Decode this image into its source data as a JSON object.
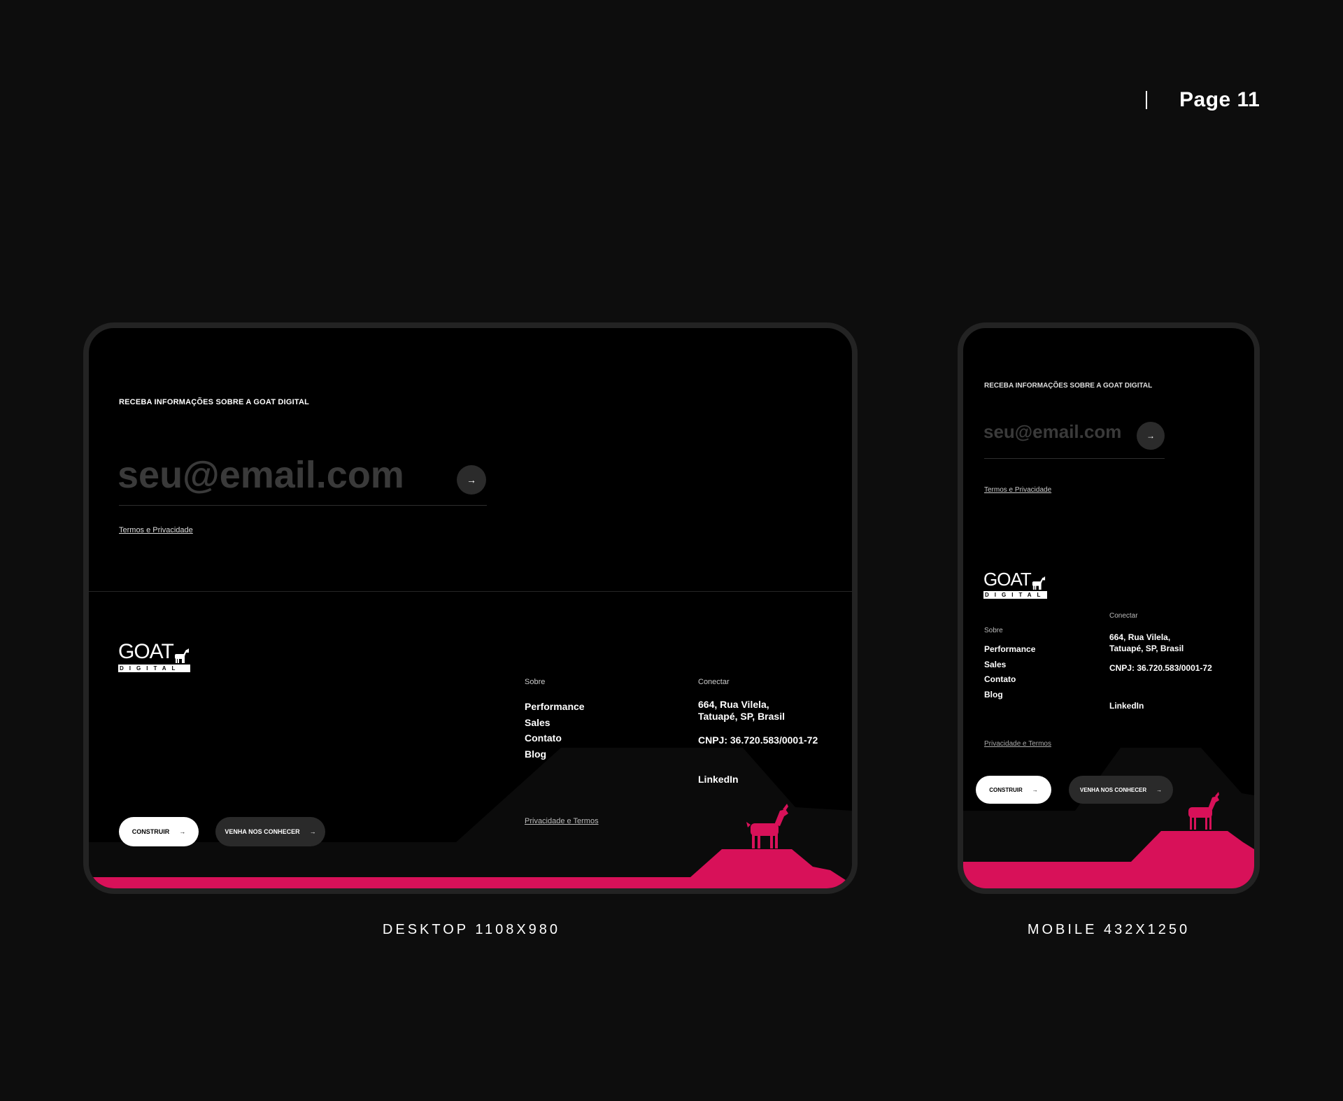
{
  "page_indicator": {
    "label": "Page 11"
  },
  "colors": {
    "accent": "#d81159",
    "background": "#0d0d0d",
    "hill": "#0b0b0b"
  },
  "desktop": {
    "caption": "DESKTOP 1108X980",
    "newsletter_title": "RECEBA INFORMAÇÕES SOBRE A GOAT DIGITAL",
    "email_placeholder": "seu@email.com",
    "submit_icon": "arrow-right-icon",
    "terms_link": "Termos e Privacidade",
    "logo": {
      "main": "GOAT",
      "sub": "DIGITAL"
    },
    "sobre": {
      "title": "Sobre",
      "items": [
        "Performance",
        "Sales",
        "Contato",
        "Blog"
      ]
    },
    "conectar": {
      "title": "Conectar",
      "address_line1": "664, Rua Vilela,",
      "address_line2": "Tatuapé, SP, Brasil",
      "cnpj": "CNPJ: 36.720.583/0001-72",
      "linkedin": "LinkedIn"
    },
    "privacy_link": "Privacidade e Termos",
    "buttons": {
      "construir": "CONSTRUIR",
      "conhecer": "VENHA NOS CONHECER"
    }
  },
  "mobile": {
    "caption": "MOBILE 432X1250",
    "newsletter_title": "RECEBA INFORMAÇÕES SOBRE A GOAT DIGITAL",
    "email_placeholder": "seu@email.com",
    "terms_link": "Termos e Privacidade",
    "logo": {
      "main": "GOAT",
      "sub": "DIGITAL"
    },
    "sobre": {
      "title": "Sobre",
      "items": [
        "Performance",
        "Sales",
        "Contato",
        "Blog"
      ]
    },
    "conectar": {
      "title": "Conectar",
      "address_line1": "664, Rua Vilela,",
      "address_line2": "Tatuapé, SP, Brasil",
      "cnpj": "CNPJ: 36.720.583/0001-72",
      "linkedin": "LinkedIn"
    },
    "privacy_link": "Privacidade e Termos",
    "buttons": {
      "construir": "CONSTRUIR",
      "conhecer": "VENHA NOS CONHECER"
    }
  }
}
